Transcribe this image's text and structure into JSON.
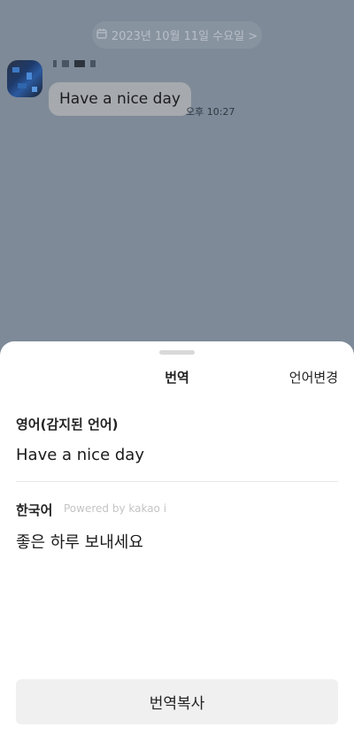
{
  "chat": {
    "date_label": "2023년 10월 11일 수요일 >",
    "message_text": "Have a nice day",
    "message_time": "오후 10:27"
  },
  "sheet": {
    "title": "번역",
    "change_language": "언어변경",
    "source_language": "영어(감지된 언어)",
    "source_text": "Have a nice day",
    "target_language": "한국어",
    "powered_by": "Powered by kakao i",
    "target_text": "좋은 하루 보내세요",
    "copy_button": "번역복사"
  },
  "colors": {
    "overlay": "#7e8a98",
    "sheet_bg": "#ffffff",
    "button_bg": "#f0f0f0"
  },
  "icons": [
    "calendar-icon"
  ]
}
